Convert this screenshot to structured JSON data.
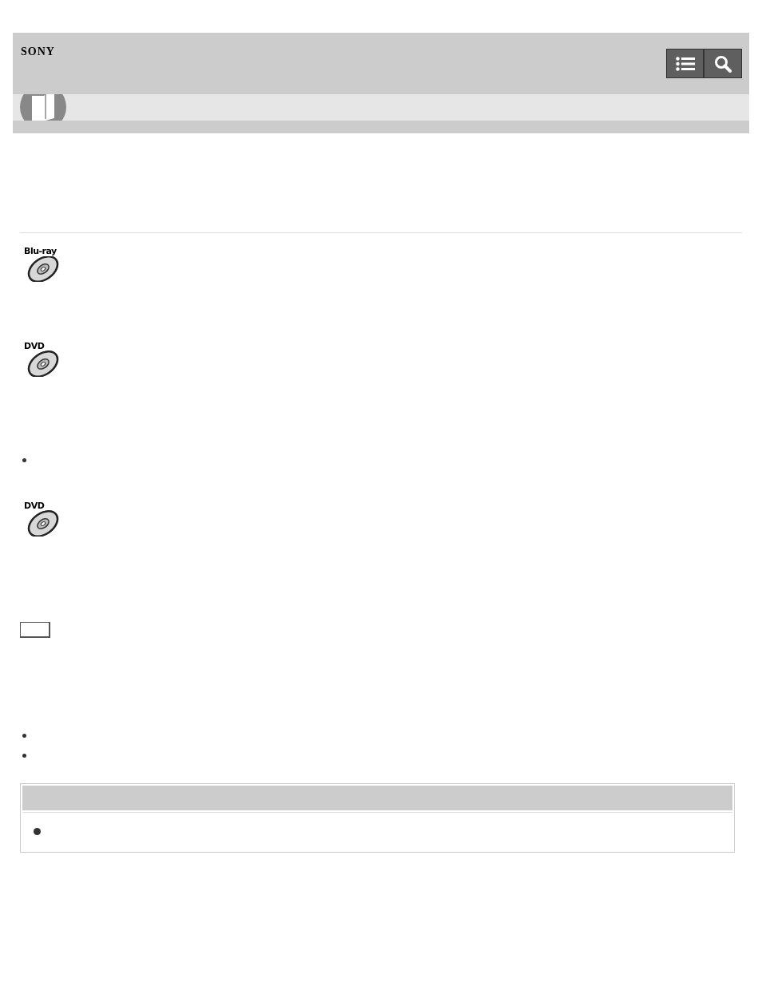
{
  "header": {
    "logo": "SONY"
  },
  "blocks": [
    {
      "kind": "disc",
      "label": "Blu-ray"
    },
    {
      "kind": "disc",
      "label": "DVD"
    },
    {
      "kind": "bullet"
    },
    {
      "kind": "disc",
      "label": "DVD"
    },
    {
      "kind": "box"
    },
    {
      "kind": "bullet"
    },
    {
      "kind": "bullet"
    },
    {
      "kind": "note"
    }
  ]
}
